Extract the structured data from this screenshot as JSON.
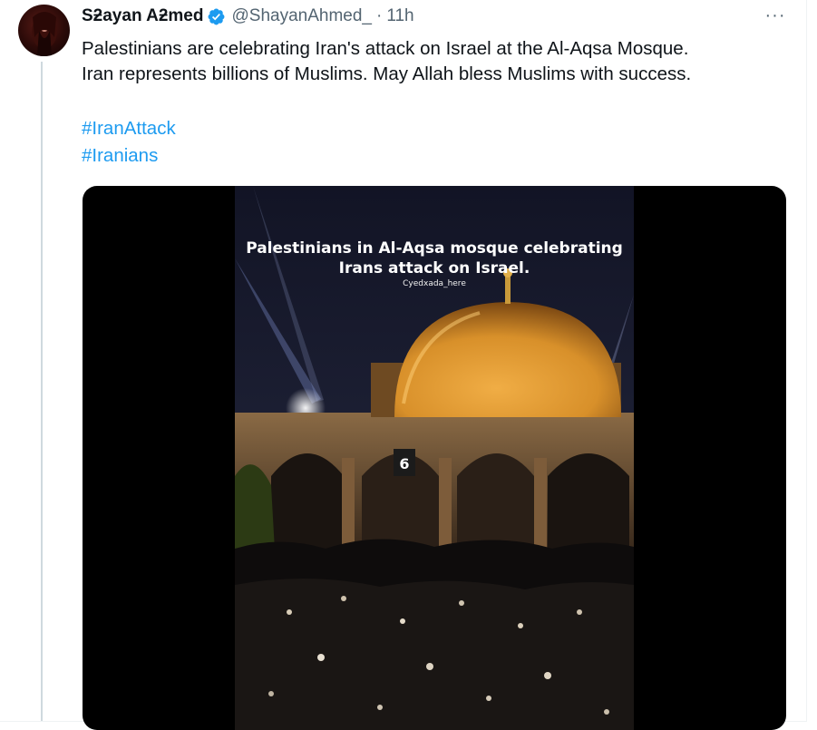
{
  "tweet": {
    "author_name": "Sƻayan Aƻmed",
    "handle": "@ShayanAhmed_",
    "separator": "·",
    "time": "11h",
    "more_label": "···",
    "text_lines": [
      "Palestinians are celebrating Iran's attack on Israel at the Al-Aqsa Mosque.",
      "Iran represents billions of Muslims. May Allah bless Muslims with success."
    ],
    "hashtags": [
      "#IranAttack",
      "#Iranians"
    ]
  },
  "media": {
    "overlay_title_lines": [
      "Palestinians in Al-Aqsa mosque celebrating",
      "Irans attack on Israel."
    ],
    "watermark": "Cyedxada_here",
    "sign_number": "6"
  },
  "colors": {
    "link": "#1d9bf0",
    "secondary_text": "#536471",
    "verified_badge": "#1d9bf0",
    "dome_gold": "#d8902a"
  },
  "icons": [
    "verified-badge-icon",
    "more-options-icon"
  ]
}
